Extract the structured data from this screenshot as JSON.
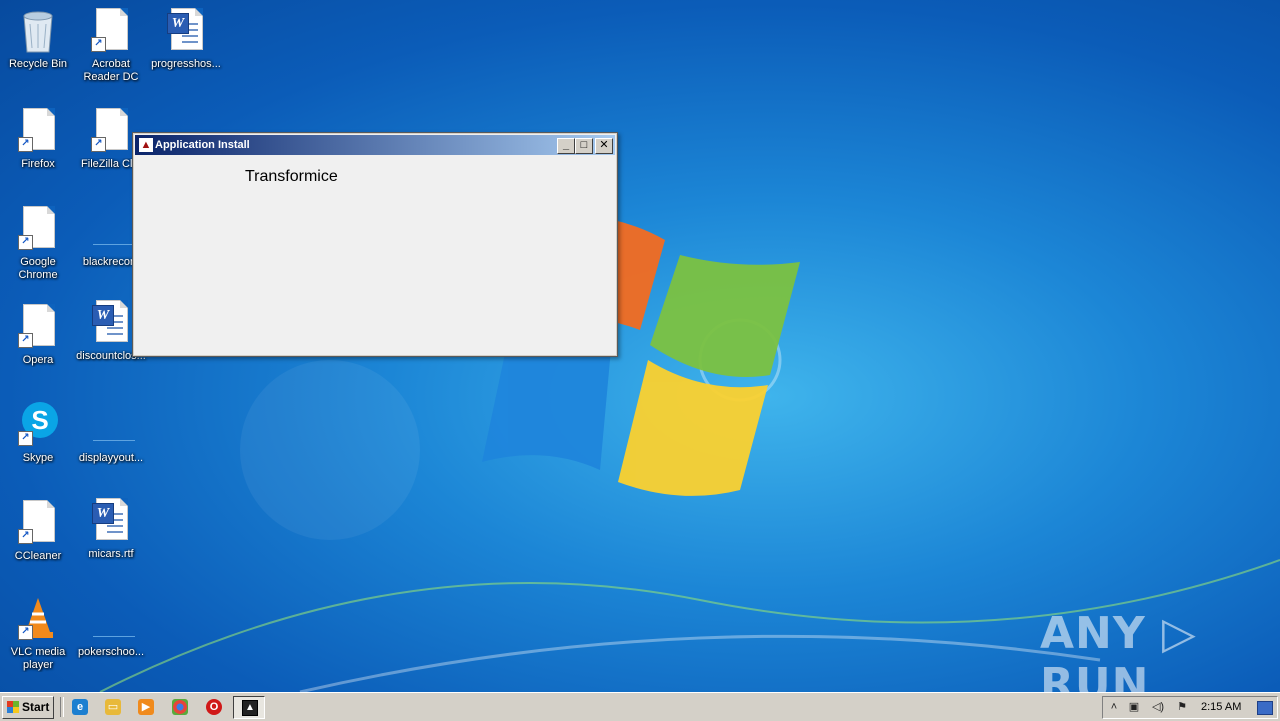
{
  "desktop": {
    "icons": [
      {
        "label": "Recycle Bin",
        "icon": "recycle-bin-icon"
      },
      {
        "label": "Acrobat Reader DC",
        "icon": "acrobat-icon"
      },
      {
        "label": "progresshos...",
        "icon": "word-document-icon"
      },
      {
        "label": "Firefox",
        "icon": "firefox-icon"
      },
      {
        "label": "FileZilla Clie",
        "icon": "filezilla-icon"
      },
      {
        "label": "Google Chrome",
        "icon": "chrome-icon"
      },
      {
        "label": "blackrecom",
        "icon": "file-icon"
      },
      {
        "label": "Opera",
        "icon": "opera-icon"
      },
      {
        "label": "discountclos...",
        "icon": "word-document-icon"
      },
      {
        "label": "Skype",
        "icon": "skype-icon"
      },
      {
        "label": "displayyout...",
        "icon": "file-icon"
      },
      {
        "label": "CCleaner",
        "icon": "ccleaner-icon"
      },
      {
        "label": "micars.rtf",
        "icon": "word-document-icon"
      },
      {
        "label": "VLC media player",
        "icon": "vlc-icon"
      },
      {
        "label": "pokerschoo...",
        "icon": "file-icon"
      }
    ]
  },
  "dialog": {
    "title": "Application Install",
    "app_name": "Transformice",
    "buttons": {
      "minimize": "_",
      "maximize": "□",
      "close": "✕"
    }
  },
  "taskbar": {
    "start_label": "Start",
    "clock": "2:15 AM",
    "quick_launch": [
      "ie-icon",
      "explorer-icon",
      "media-player-icon",
      "chrome-icon",
      "opera-icon"
    ],
    "tray": [
      "show-hidden-icon",
      "network-icon",
      "volume-icon",
      "flag-icon"
    ]
  },
  "watermark": "ANY ▷ RUN",
  "colors": {
    "titlebar_start": "#0a246a",
    "titlebar_end": "#a6caf0",
    "taskbar": "#d4d0c8"
  }
}
